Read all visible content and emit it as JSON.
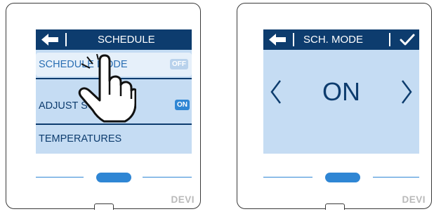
{
  "brand": "DEVI",
  "colors": {
    "header": "#0d3c6e",
    "screen": "#c5dcf3",
    "accent": "#2f86d4",
    "text": "#0d3c6e"
  },
  "left_screen": {
    "title": "SCHEDULE",
    "items": [
      {
        "label": "SCHEDULE MODE",
        "badge": "OFF",
        "selected": true
      },
      {
        "label": "ADJUST SCHEDULE",
        "badge": "ON",
        "selected": false
      },
      {
        "label": "TEMPERATURES"
      }
    ]
  },
  "right_screen": {
    "title": "SCH. MODE",
    "value": "ON"
  },
  "icons": [
    "back-arrow-icon",
    "check-icon",
    "chevron-left-icon",
    "chevron-right-icon",
    "pointing-hand-icon"
  ]
}
